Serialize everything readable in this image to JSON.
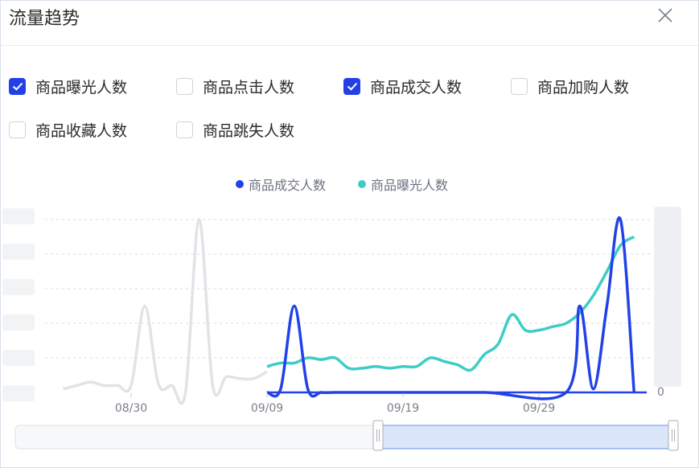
{
  "dialog": {
    "title": "流量趋势",
    "close_icon": "close-icon"
  },
  "options": [
    {
      "label": "商品曝光人数",
      "checked": true
    },
    {
      "label": "商品点击人数",
      "checked": false
    },
    {
      "label": "商品成交人数",
      "checked": true
    },
    {
      "label": "商品加购人数",
      "checked": false
    },
    {
      "label": "商品收藏人数",
      "checked": false
    },
    {
      "label": "商品跳失人数",
      "checked": false
    }
  ],
  "colors": {
    "deal": "#2242e8",
    "exposure": "#3ecdc6",
    "preview": "#e1e3e7",
    "accent": "#2240e6"
  },
  "chart_data": {
    "type": "line",
    "title": "",
    "xlabel": "",
    "ylabel": "",
    "grid": true,
    "legend_position": "top-center",
    "x_ticks": [
      "08/30",
      "09/09",
      "09/19",
      "09/29"
    ],
    "y_ticks": [
      "0"
    ],
    "x_range": [
      "09/09",
      "10/06"
    ],
    "ylim": [
      0,
      1.0
    ],
    "series": [
      {
        "name": "商品成交人数",
        "x": [
          "09/09",
          "09/10",
          "09/11",
          "09/12",
          "09/13",
          "09/14",
          "09/15",
          "09/20",
          "09/25",
          "10/01",
          "10/02",
          "10/03",
          "10/04",
          "10/05",
          "10/06"
        ],
        "values": [
          0,
          0.02,
          0.5,
          0.02,
          0,
          0,
          0,
          0,
          0,
          0,
          0.5,
          0.02,
          0.5,
          1.0,
          0
        ]
      },
      {
        "name": "商品曝光人数",
        "x": [
          "09/09",
          "09/10",
          "09/11",
          "09/12",
          "09/13",
          "09/14",
          "09/15",
          "09/16",
          "09/17",
          "09/18",
          "09/19",
          "09/20",
          "09/21",
          "09/22",
          "09/23",
          "09/24",
          "09/25",
          "09/26",
          "09/27",
          "09/28",
          "09/29",
          "09/30",
          "10/01",
          "10/02",
          "10/03",
          "10/04",
          "10/05",
          "10/06"
        ],
        "values": [
          0.15,
          0.17,
          0.17,
          0.2,
          0.19,
          0.2,
          0.14,
          0.14,
          0.15,
          0.14,
          0.15,
          0.15,
          0.2,
          0.18,
          0.16,
          0.13,
          0.22,
          0.28,
          0.45,
          0.36,
          0.36,
          0.38,
          0.4,
          0.46,
          0.56,
          0.7,
          0.85,
          0.9
        ]
      }
    ],
    "preview_series": {
      "x": [
        "08/25",
        "08/26",
        "08/27",
        "08/28",
        "08/29",
        "08/30",
        "08/31",
        "09/01",
        "09/02",
        "09/03",
        "09/04",
        "09/05",
        "09/06",
        "09/07",
        "09/08",
        "09/09"
      ],
      "values": [
        0.02,
        0.04,
        0.06,
        0.04,
        0.04,
        0.04,
        0.5,
        0.05,
        0.04,
        0.0,
        1.0,
        0.04,
        0.09,
        0.08,
        0.08,
        0.12
      ]
    },
    "range_selector": {
      "start": "09/09",
      "end": "10/06"
    }
  }
}
